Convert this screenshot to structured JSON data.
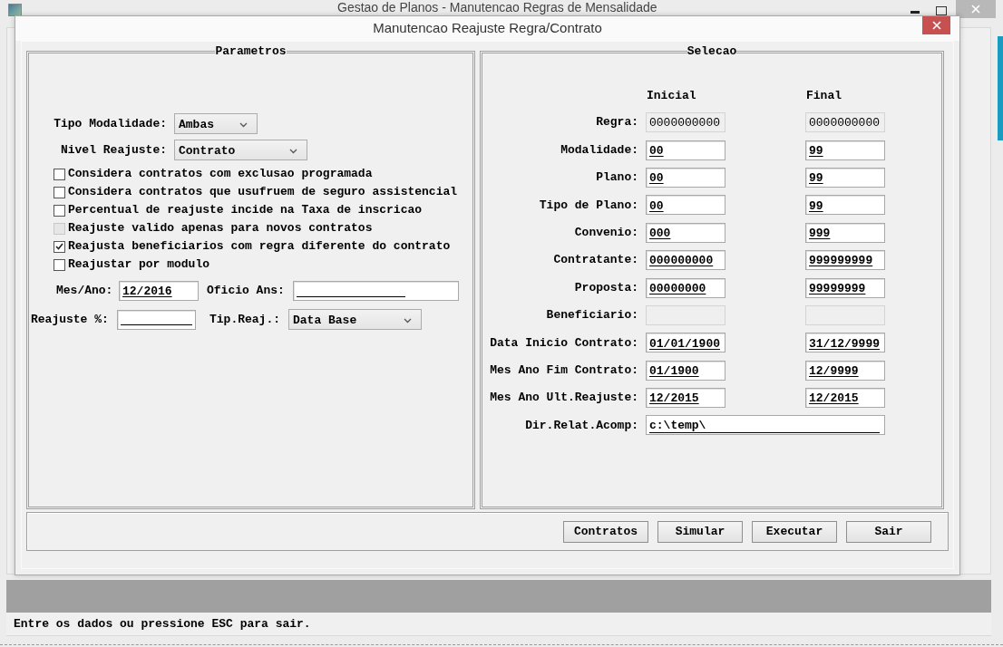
{
  "window": {
    "title": "Gestao de Planos - Manutencao Regras de Mensalidade"
  },
  "dialog": {
    "title": "Manutencao Reajuste Regra/Contrato"
  },
  "parameters": {
    "title": "Parametros",
    "selects": [
      {
        "label": "Tipo Modalidade:",
        "value": "Ambas"
      },
      {
        "label": "Nivel Reajuste:",
        "value": "Contrato"
      }
    ],
    "checkboxes": [
      {
        "label": "Considera contratos com exclusao programada",
        "checked": false,
        "disabled": false
      },
      {
        "label": "Considera contratos que usufruem de seguro assistencial",
        "checked": false,
        "disabled": false
      },
      {
        "label": "Percentual de reajuste incide na Taxa de inscricao",
        "checked": false,
        "disabled": false
      },
      {
        "label": "Reajuste valido apenas para novos contratos",
        "checked": false,
        "disabled": true
      },
      {
        "label": "Reajusta beneficiarios com regra diferente do contrato",
        "checked": true,
        "disabled": false
      },
      {
        "label": "Reajustar por modulo",
        "checked": false,
        "disabled": false
      }
    ],
    "rows": [
      [
        {
          "kind": "text",
          "label": "Mes/Ano:",
          "value": "12/2016"
        },
        {
          "kind": "text",
          "label": "Oficio Ans:"
        }
      ],
      [
        {
          "kind": "text",
          "label": "Reajuste %:"
        },
        {
          "kind": "select",
          "label": "Tip.Reaj.:",
          "value": "Data Base"
        }
      ]
    ]
  },
  "selection": {
    "title": "Selecao",
    "columns": [
      "Inicial",
      "Final"
    ],
    "rows": [
      {
        "label": "Regra:",
        "initial": "0000000000",
        "final": "0000000000",
        "disabled": true
      },
      {
        "label": "Modalidade:",
        "initial": "00",
        "final": "99",
        "disabled": false
      },
      {
        "label": "Plano:",
        "initial": "00",
        "final": "99",
        "disabled": false
      },
      {
        "label": "Tipo de Plano:",
        "initial": "00",
        "final": "99",
        "disabled": false
      },
      {
        "label": "Convenio:",
        "initial": "000",
        "final": "999",
        "disabled": false
      },
      {
        "label": "Contratante:",
        "initial": "000000000",
        "final": "999999999",
        "disabled": false
      },
      {
        "label": "Proposta:",
        "initial": "00000000",
        "final": "99999999",
        "disabled": false
      },
      {
        "label": "Beneficiario:",
        "disabled": true
      },
      {
        "label": "Data Inicio Contrato:",
        "initial": "01/01/1900",
        "final": "31/12/9999",
        "disabled": false
      },
      {
        "label": "Mes Ano Fim Contrato:",
        "initial": "01/1900",
        "final": "12/9999",
        "disabled": false
      },
      {
        "label": "Mes Ano Ult.Reajuste:",
        "initial": "12/2015",
        "final": "12/2015",
        "disabled": false
      }
    ],
    "directory": {
      "label": "Dir.Relat.Acomp:",
      "value": "c:\\temp\\"
    }
  },
  "buttons": [
    "Contratos",
    "Simular",
    "Executar",
    "Sair"
  ],
  "status_bar": "Entre os dados ou pressione ESC para sair."
}
